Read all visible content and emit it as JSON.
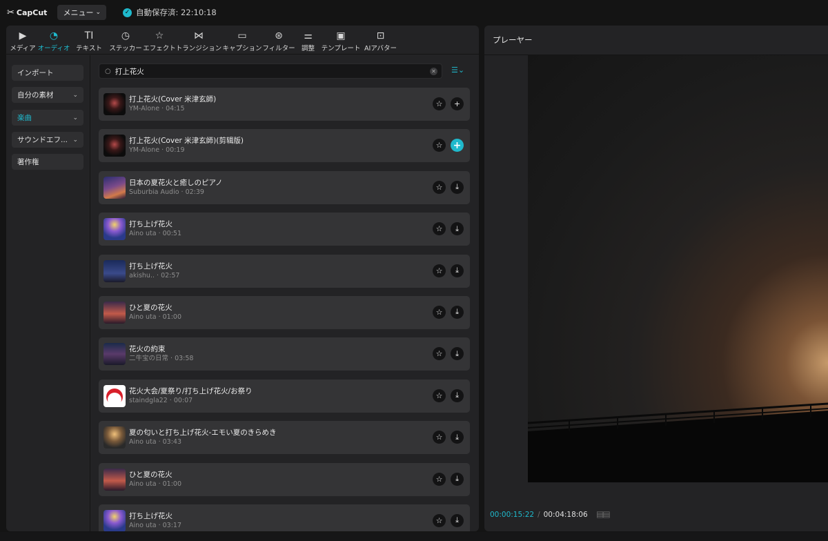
{
  "app": {
    "name": "CapCut",
    "menu_label": "メニュー",
    "autosave_text": "自動保存済: 22:10:18"
  },
  "toolbar": [
    {
      "label": "メディア",
      "icon": "media-icon"
    },
    {
      "label": "オーディオ",
      "icon": "audio-icon",
      "active": true
    },
    {
      "label": "テキスト",
      "icon": "text-icon"
    },
    {
      "label": "ステッカー",
      "icon": "sticker-icon"
    },
    {
      "label": "エフェクト",
      "icon": "effect-icon"
    },
    {
      "label": "トランジション",
      "icon": "transition-icon"
    },
    {
      "label": "キャプション",
      "icon": "caption-icon"
    },
    {
      "label": "フィルター",
      "icon": "filter-icon"
    },
    {
      "label": "調整",
      "icon": "adjust-icon"
    },
    {
      "label": "テンプレート",
      "icon": "template-icon"
    },
    {
      "label": "AIアバター",
      "icon": "ai-avatar-icon"
    }
  ],
  "sidebar": [
    {
      "label": "インポート"
    },
    {
      "label": "自分の素材",
      "chevron": true
    },
    {
      "label": "楽曲",
      "chevron": true,
      "active": true
    },
    {
      "label": "サウンドエフ...",
      "chevron": true
    },
    {
      "label": "著作権"
    }
  ],
  "search": {
    "value": "打上花火"
  },
  "tracks": [
    {
      "title": "打上花火(Cover 米津玄師)",
      "artist": "YM-Alone",
      "duration": "04:15",
      "action": "add"
    },
    {
      "title": "打上花火(Cover 米津玄師)(剪辑版)",
      "artist": "YM-Alone",
      "duration": "00:19",
      "action": "add-active"
    },
    {
      "title": "日本の夏花火と癒しのピアノ",
      "artist": "Suburbia Audio",
      "duration": "02:39",
      "action": "download"
    },
    {
      "title": "打ち上げ花火",
      "artist": "Aino uta",
      "duration": "00:51",
      "action": "download"
    },
    {
      "title": "打ち上げ花火",
      "artist": "akishu..",
      "duration": "02:57",
      "action": "download"
    },
    {
      "title": "ひと夏の花火",
      "artist": "Aino uta",
      "duration": "01:00",
      "action": "download"
    },
    {
      "title": "花火の約束",
      "artist": "二牛宝の日常",
      "duration": "03:58",
      "action": "download"
    },
    {
      "title": "花火大会/夏祭り/打ち上げ花火/お祭り",
      "artist": "staindgla22",
      "duration": "00:07",
      "action": "download"
    },
    {
      "title": "夏の匂いと打ち上げ花火-エモい夏のきらめき",
      "artist": "Aino uta",
      "duration": "03:43",
      "action": "download"
    },
    {
      "title": "ひと夏の花火",
      "artist": "Aino uta",
      "duration": "01:00",
      "action": "download"
    },
    {
      "title": "打ち上げ花火",
      "artist": "Aino uta",
      "duration": "03:17",
      "action": "download"
    }
  ],
  "player": {
    "title": "プレーヤー",
    "current_time": "00:00:15:22",
    "separator": "/",
    "total_time": "00:04:18:06"
  },
  "colors": {
    "accent": "#1fb9cc",
    "panel": "#232325",
    "background": "#141414"
  }
}
